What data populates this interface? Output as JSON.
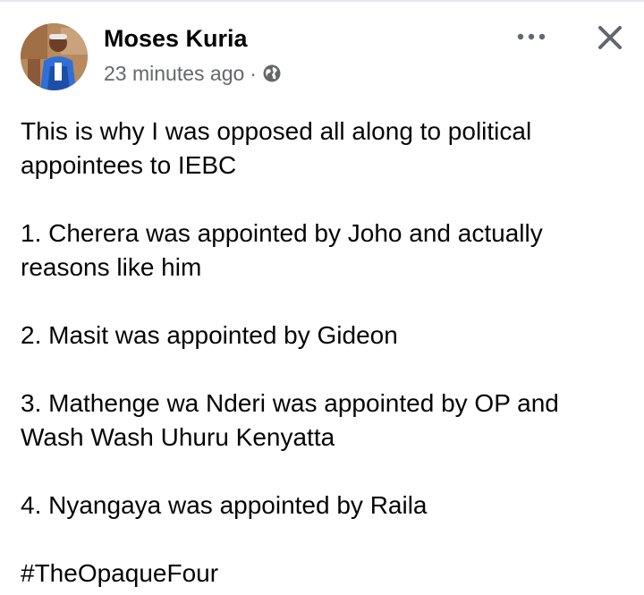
{
  "post": {
    "author": "Moses Kuria",
    "timestamp": "23 minutes ago",
    "separator": "·",
    "privacy_icon": "globe-icon",
    "more_icon": "more-options-icon",
    "close_icon": "close-icon",
    "paragraphs": [
      "This is why I was opposed all along to political appointees to IEBC",
      "1. Cherera was appointed by Joho and actually reasons like him",
      "2. Masit was appointed by Gideon",
      "3. Mathenge wa Nderi was appointed by OP and Wash Wash Uhuru Kenyatta",
      "4. Nyangaya was appointed by Raila",
      "#TheOpaqueFour"
    ]
  },
  "colors": {
    "text": "#050505",
    "secondary_text": "#65676b",
    "icon": "#606770"
  }
}
